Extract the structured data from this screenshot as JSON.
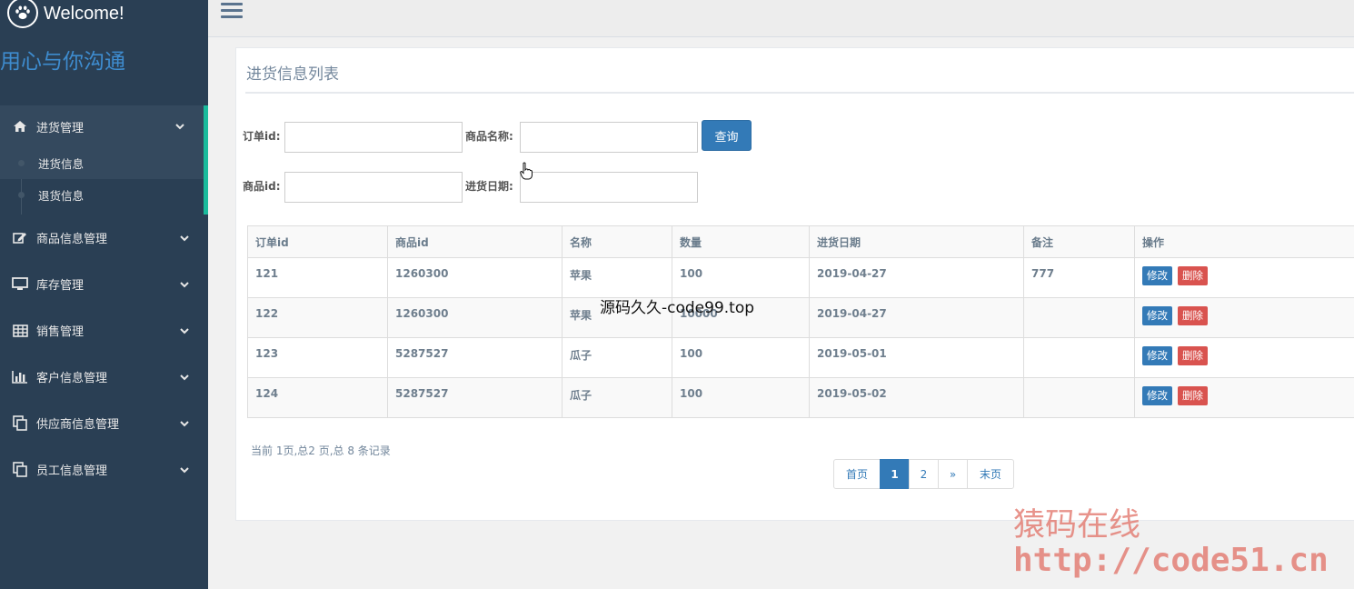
{
  "brand": {
    "title": "Welcome!",
    "slogan": "用心与你沟通"
  },
  "sidebar": {
    "items": [
      {
        "label": "进货管理",
        "icon": "home-icon",
        "expanded": true,
        "children": [
          {
            "label": "进货信息",
            "current": true
          },
          {
            "label": "退货信息"
          }
        ]
      },
      {
        "label": "商品信息管理",
        "icon": "edit-icon"
      },
      {
        "label": "库存管理",
        "icon": "desktop-icon"
      },
      {
        "label": "销售管理",
        "icon": "table-icon"
      },
      {
        "label": "客户信息管理",
        "icon": "bar-chart-icon"
      },
      {
        "label": "供应商信息管理",
        "icon": "copy-icon"
      },
      {
        "label": "员工信息管理",
        "icon": "copy-icon"
      }
    ]
  },
  "panel": {
    "title": "进货信息列表"
  },
  "search": {
    "order_id_label": "订单id:",
    "product_name_label": "商品名称:",
    "product_id_label": "商品id:",
    "date_label": "进货日期:",
    "query_button": "查询",
    "order_id_value": "",
    "product_name_value": "",
    "product_id_value": "",
    "date_value": ""
  },
  "table": {
    "headers": [
      "订单id",
      "商品id",
      "名称",
      "数量",
      "进货日期",
      "备注",
      "操作"
    ],
    "rows": [
      {
        "order_id": "121",
        "product_id": "1260300",
        "name": "苹果",
        "qty": "100",
        "date": "2019-04-27",
        "note": "777"
      },
      {
        "order_id": "122",
        "product_id": "1260300",
        "name": "苹果",
        "qty": "10000",
        "date": "2019-04-27",
        "note": ""
      },
      {
        "order_id": "123",
        "product_id": "5287527",
        "name": "瓜子",
        "qty": "100",
        "date": "2019-05-01",
        "note": ""
      },
      {
        "order_id": "124",
        "product_id": "5287527",
        "name": "瓜子",
        "qty": "100",
        "date": "2019-05-02",
        "note": ""
      }
    ],
    "edit_label": "修改",
    "delete_label": "删除"
  },
  "pagination": {
    "summary": "当前 1页,总2 页,总 8 条记录",
    "first": "首页",
    "pages": [
      "1",
      "2"
    ],
    "current_page": "1",
    "next": "»",
    "last": "末页"
  },
  "watermarks": {
    "center": "源码久久-code99.top",
    "site_name": "猿码在线",
    "site_url": "http://code51.cn"
  },
  "colors": {
    "sidebar": "#2a3f54",
    "accent": "#1abb9c",
    "primary": "#337ab7",
    "danger": "#d9534f"
  }
}
